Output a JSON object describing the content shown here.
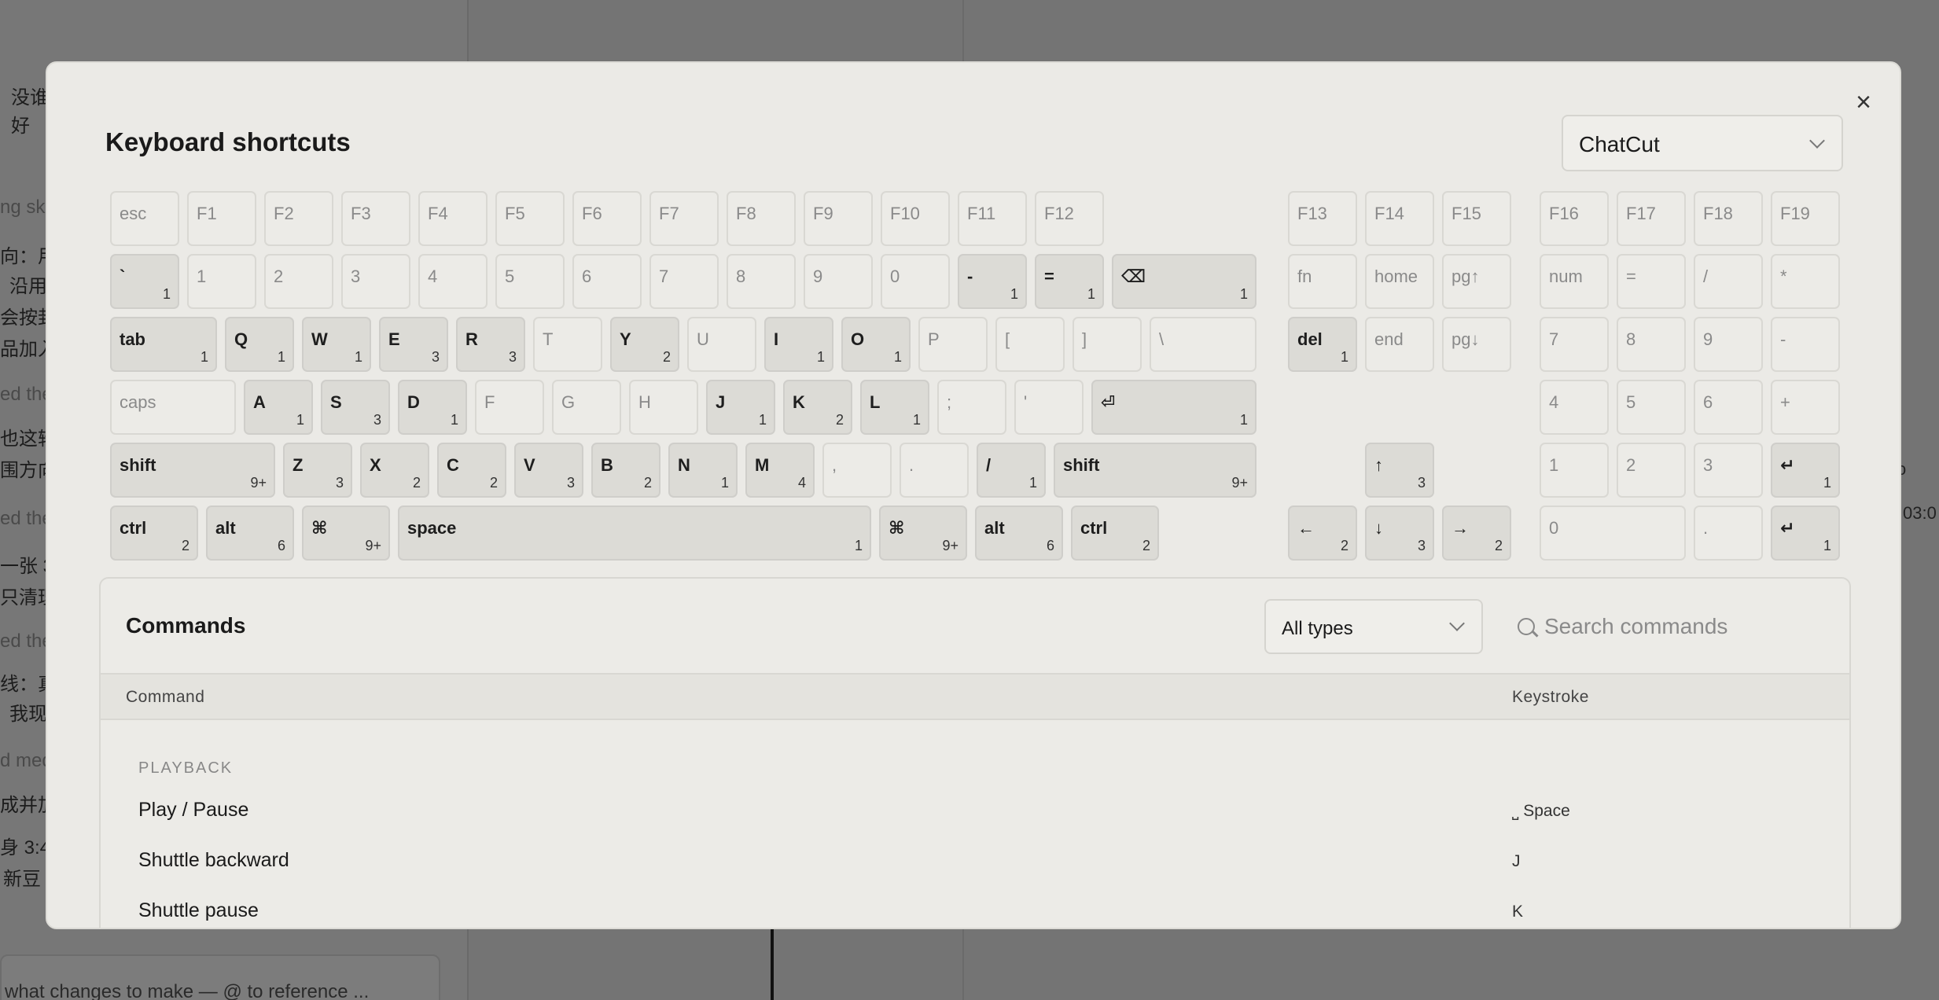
{
  "background": {
    "left_snippets": [
      "没谁",
      "好",
      "ng sk",
      "向：用",
      "沿用",
      "会按封",
      "品加入",
      "ed the",
      "也这轮",
      "围方向",
      "ed the",
      "一张 3",
      "只清理",
      "ed the",
      "线：真",
      "我现",
      "d med",
      "成并加",
      "身 3:4",
      "新豆"
    ],
    "input_placeholder": "what changes to make — @ to reference ...",
    "right_chip": "o",
    "right_time": "03:0"
  },
  "modal": {
    "title": "Keyboard shortcuts",
    "close_label": "×",
    "preset": "ChatCut"
  },
  "keyboard": [
    {
      "label": "esc"
    },
    {
      "label": "F1"
    },
    {
      "label": "F2"
    },
    {
      "label": "F3"
    },
    {
      "label": "F4"
    },
    {
      "label": "F5"
    },
    {
      "label": "F6"
    },
    {
      "label": "F7"
    },
    {
      "label": "F8"
    },
    {
      "label": "F9"
    },
    {
      "label": "F10"
    },
    {
      "label": "F11"
    },
    {
      "label": "F12"
    },
    {
      "label": "F13"
    },
    {
      "label": "F14"
    },
    {
      "label": "F15"
    },
    {
      "label": "F16"
    },
    {
      "label": "F17"
    },
    {
      "label": "F18"
    },
    {
      "label": "F19"
    },
    {
      "label": "`",
      "count": "1"
    },
    {
      "label": "1"
    },
    {
      "label": "2"
    },
    {
      "label": "3"
    },
    {
      "label": "4"
    },
    {
      "label": "5"
    },
    {
      "label": "6"
    },
    {
      "label": "7"
    },
    {
      "label": "8"
    },
    {
      "label": "9"
    },
    {
      "label": "0"
    },
    {
      "label": "-",
      "count": "1"
    },
    {
      "label": "=",
      "count": "1"
    },
    {
      "label": "⌫",
      "count": "1"
    },
    {
      "label": "fn"
    },
    {
      "label": "home"
    },
    {
      "label": "pg↑"
    },
    {
      "label": "num"
    },
    {
      "label": "="
    },
    {
      "label": "/"
    },
    {
      "label": "*"
    },
    {
      "label": "tab",
      "count": "1"
    },
    {
      "label": "Q",
      "count": "1"
    },
    {
      "label": "W",
      "count": "1"
    },
    {
      "label": "E",
      "count": "3"
    },
    {
      "label": "R",
      "count": "3"
    },
    {
      "label": "T"
    },
    {
      "label": "Y",
      "count": "2"
    },
    {
      "label": "U"
    },
    {
      "label": "I",
      "count": "1"
    },
    {
      "label": "O",
      "count": "1"
    },
    {
      "label": "P"
    },
    {
      "label": "["
    },
    {
      "label": "]"
    },
    {
      "label": "\\"
    },
    {
      "label": "del",
      "count": "1"
    },
    {
      "label": "end"
    },
    {
      "label": "pg↓"
    },
    {
      "label": "7"
    },
    {
      "label": "8"
    },
    {
      "label": "9"
    },
    {
      "label": "-"
    },
    {
      "label": "caps"
    },
    {
      "label": "A",
      "count": "1"
    },
    {
      "label": "S",
      "count": "3"
    },
    {
      "label": "D",
      "count": "1"
    },
    {
      "label": "F"
    },
    {
      "label": "G"
    },
    {
      "label": "H"
    },
    {
      "label": "J",
      "count": "1"
    },
    {
      "label": "K",
      "count": "2"
    },
    {
      "label": "L",
      "count": "1"
    },
    {
      "label": ";"
    },
    {
      "label": "'"
    },
    {
      "label": "⏎",
      "count": "1"
    },
    {
      "label": "4"
    },
    {
      "label": "5"
    },
    {
      "label": "6"
    },
    {
      "label": "+"
    },
    {
      "label": "shift",
      "count": "9+"
    },
    {
      "label": "Z",
      "count": "3"
    },
    {
      "label": "X",
      "count": "2"
    },
    {
      "label": "C",
      "count": "2"
    },
    {
      "label": "V",
      "count": "3"
    },
    {
      "label": "B",
      "count": "2"
    },
    {
      "label": "N",
      "count": "1"
    },
    {
      "label": "M",
      "count": "4"
    },
    {
      "label": ","
    },
    {
      "label": "."
    },
    {
      "label": "/",
      "count": "1"
    },
    {
      "label": "shift",
      "count": "9+"
    },
    {
      "label": "↑",
      "count": "3"
    },
    {
      "label": "1"
    },
    {
      "label": "2"
    },
    {
      "label": "3"
    },
    {
      "label": "↵",
      "count": "1"
    },
    {
      "label": "ctrl",
      "count": "2"
    },
    {
      "label": "alt",
      "count": "6"
    },
    {
      "label": "⌘",
      "count": "9+"
    },
    {
      "label": "space",
      "count": "1"
    },
    {
      "label": "⌘",
      "count": "9+"
    },
    {
      "label": "alt",
      "count": "6"
    },
    {
      "label": "ctrl",
      "count": "2"
    },
    {
      "label": "←",
      "count": "2"
    },
    {
      "label": "↓",
      "count": "3"
    },
    {
      "label": "→",
      "count": "2"
    },
    {
      "label": "0"
    },
    {
      "label": "."
    },
    {
      "label": "↵",
      "count": "1"
    }
  ],
  "commands": {
    "title": "Commands",
    "type_filter": "All types",
    "search_placeholder": "Search commands",
    "col_command": "Command",
    "col_keystroke": "Keystroke",
    "group": "PLAYBACK",
    "rows": [
      {
        "name": "Play / Pause",
        "keystroke": "⎵ Space"
      },
      {
        "name": "Shuttle backward",
        "keystroke": "J"
      },
      {
        "name": "Shuttle pause",
        "keystroke": "K"
      }
    ]
  }
}
